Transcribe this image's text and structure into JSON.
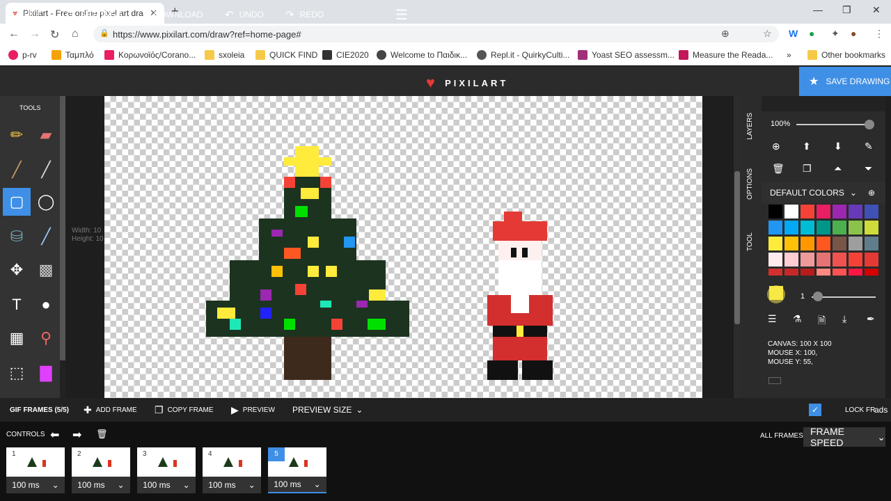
{
  "browser": {
    "tab_title": "Pixilart - Free online pixel art dra",
    "url": "https://www.pixilart.com/draw?ref=home-page#",
    "bookmarks": [
      "p-rv",
      "Ταμπλό",
      "Κορωνοϊός/Corano...",
      "sxoleia",
      "QUICK FIND",
      "CIE2020",
      "Welcome to Παιδικ...",
      "Repl.it - QuirkyCulti...",
      "Yoast SEO assessm...",
      "Measure the Reada..."
    ],
    "other_bookmarks": "Other bookmarks",
    "more": "»"
  },
  "topbar": {
    "file": "FILE",
    "settings": "SETTINGS",
    "download": "DOWNLOAD",
    "undo": "UNDO",
    "redo": "REDO",
    "logo": "PIXILART",
    "save": "SAVE DRAWING"
  },
  "tools": {
    "title": "TOOLS"
  },
  "workspace": {
    "width_label": "Width: 10",
    "height_label": "Height: 10"
  },
  "side_tabs": {
    "layers": "LAYERS",
    "options": "OPTIONS",
    "tool": "TOOL"
  },
  "panel": {
    "zoom": "100%",
    "palette_title": "DEFAULT COLORS",
    "brush_size": "1",
    "canvas_info": "CANVAS: 100 X 100",
    "mouse_x": "MOUSE X: 100,",
    "mouse_y": "MOUSE Y: 55,",
    "colors": [
      "#000000",
      "#ffffff",
      "#f44336",
      "#e91e63",
      "#9c27b0",
      "#673ab7",
      "#3f51b5",
      "#2196f3",
      "#03a9f4",
      "#00bcd4",
      "#009688",
      "#4caf50",
      "#8bc34a",
      "#cddc39",
      "#ffeb3b",
      "#ffc107",
      "#ff9800",
      "#ff5722",
      "#795548",
      "#9e9e9e",
      "#607d8b",
      "#ffebee",
      "#ffcdd2",
      "#ef9a9a",
      "#e57373",
      "#ef5350",
      "#f44336",
      "#e53935",
      "#d32f2f",
      "#c62828",
      "#b71c1c",
      "#ff8a80",
      "#ff5252",
      "#ff1744",
      "#d50000"
    ],
    "selected_color": "#ffeb3b"
  },
  "bottombar": {
    "gif_frames": "GIF FRAMES (5/5)",
    "add_frame": "ADD FRAME",
    "copy_frame": "COPY FRAME",
    "preview": "PREVIEW",
    "preview_size": "PREVIEW SIZE",
    "lock": "LOCK FR",
    "ads": "ads",
    "controls": "CONTROLS",
    "all_frames": "ALL FRAMES",
    "frame_speed": "FRAME SPEED"
  },
  "frames": [
    {
      "num": "1",
      "speed": "100 ms"
    },
    {
      "num": "2",
      "speed": "100 ms"
    },
    {
      "num": "3",
      "speed": "100 ms"
    },
    {
      "num": "4",
      "speed": "100 ms"
    },
    {
      "num": "5",
      "speed": "100 ms"
    }
  ]
}
